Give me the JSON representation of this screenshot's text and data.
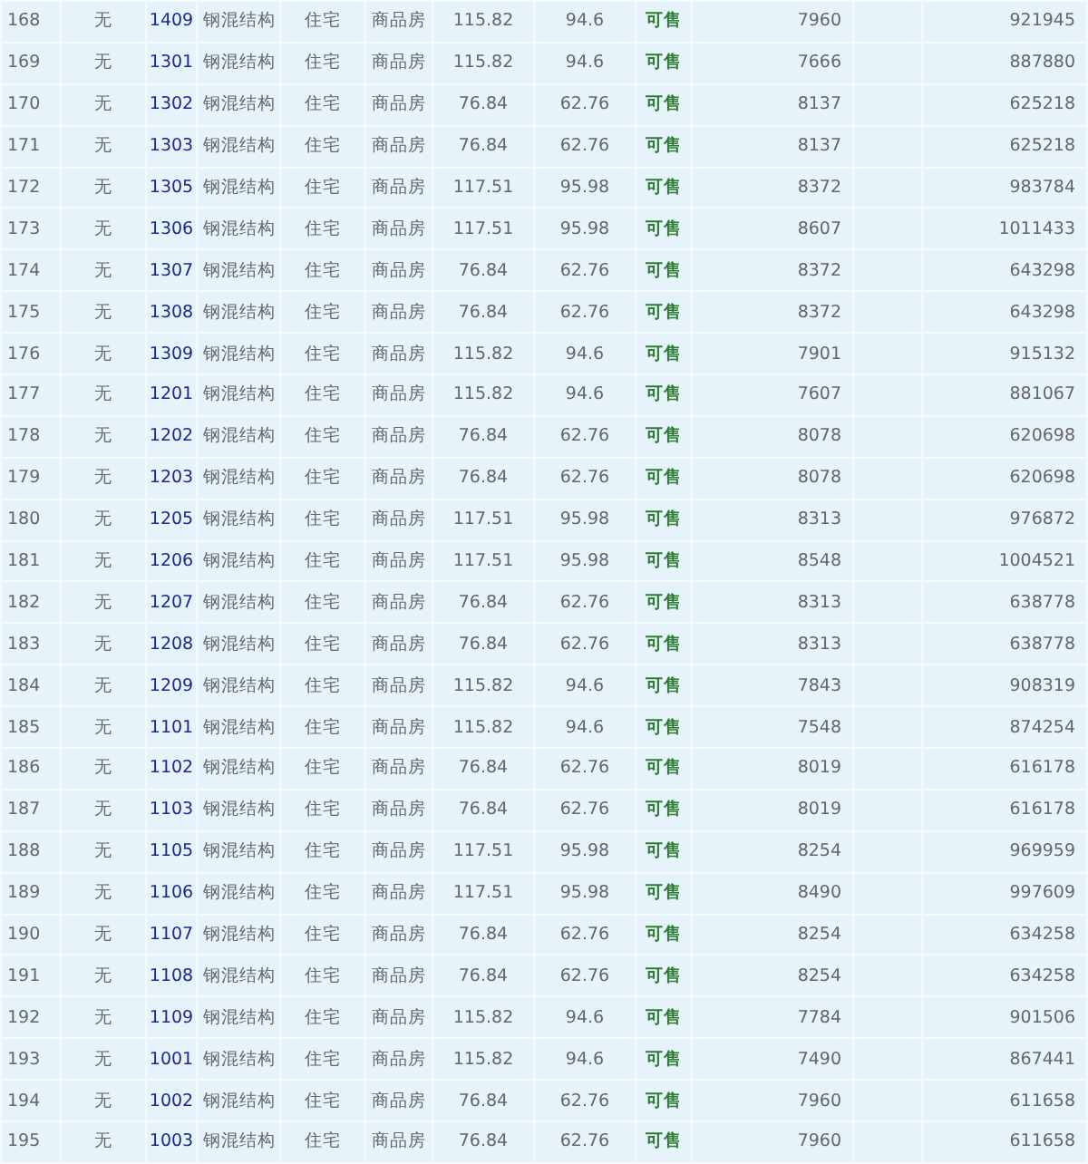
{
  "table": {
    "rows": [
      [
        "168",
        "无",
        "1409",
        "钢混结构",
        "住宅",
        "商品房",
        "115.82",
        "94.6",
        "可售",
        "7960",
        "921945"
      ],
      [
        "169",
        "无",
        "1301",
        "钢混结构",
        "住宅",
        "商品房",
        "115.82",
        "94.6",
        "可售",
        "7666",
        "887880"
      ],
      [
        "170",
        "无",
        "1302",
        "钢混结构",
        "住宅",
        "商品房",
        "76.84",
        "62.76",
        "可售",
        "8137",
        "625218"
      ],
      [
        "171",
        "无",
        "1303",
        "钢混结构",
        "住宅",
        "商品房",
        "76.84",
        "62.76",
        "可售",
        "8137",
        "625218"
      ],
      [
        "172",
        "无",
        "1305",
        "钢混结构",
        "住宅",
        "商品房",
        "117.51",
        "95.98",
        "可售",
        "8372",
        "983784"
      ],
      [
        "173",
        "无",
        "1306",
        "钢混结构",
        "住宅",
        "商品房",
        "117.51",
        "95.98",
        "可售",
        "8607",
        "1011433"
      ],
      [
        "174",
        "无",
        "1307",
        "钢混结构",
        "住宅",
        "商品房",
        "76.84",
        "62.76",
        "可售",
        "8372",
        "643298"
      ],
      [
        "175",
        "无",
        "1308",
        "钢混结构",
        "住宅",
        "商品房",
        "76.84",
        "62.76",
        "可售",
        "8372",
        "643298"
      ],
      [
        "176",
        "无",
        "1309",
        "钢混结构",
        "住宅",
        "商品房",
        "115.82",
        "94.6",
        "可售",
        "7901",
        "915132"
      ],
      [
        "177",
        "无",
        "1201",
        "钢混结构",
        "住宅",
        "商品房",
        "115.82",
        "94.6",
        "可售",
        "7607",
        "881067"
      ],
      [
        "178",
        "无",
        "1202",
        "钢混结构",
        "住宅",
        "商品房",
        "76.84",
        "62.76",
        "可售",
        "8078",
        "620698"
      ],
      [
        "179",
        "无",
        "1203",
        "钢混结构",
        "住宅",
        "商品房",
        "76.84",
        "62.76",
        "可售",
        "8078",
        "620698"
      ],
      [
        "180",
        "无",
        "1205",
        "钢混结构",
        "住宅",
        "商品房",
        "117.51",
        "95.98",
        "可售",
        "8313",
        "976872"
      ],
      [
        "181",
        "无",
        "1206",
        "钢混结构",
        "住宅",
        "商品房",
        "117.51",
        "95.98",
        "可售",
        "8548",
        "1004521"
      ],
      [
        "182",
        "无",
        "1207",
        "钢混结构",
        "住宅",
        "商品房",
        "76.84",
        "62.76",
        "可售",
        "8313",
        "638778"
      ],
      [
        "183",
        "无",
        "1208",
        "钢混结构",
        "住宅",
        "商品房",
        "76.84",
        "62.76",
        "可售",
        "8313",
        "638778"
      ],
      [
        "184",
        "无",
        "1209",
        "钢混结构",
        "住宅",
        "商品房",
        "115.82",
        "94.6",
        "可售",
        "7843",
        "908319"
      ],
      [
        "185",
        "无",
        "1101",
        "钢混结构",
        "住宅",
        "商品房",
        "115.82",
        "94.6",
        "可售",
        "7548",
        "874254"
      ],
      [
        "186",
        "无",
        "1102",
        "钢混结构",
        "住宅",
        "商品房",
        "76.84",
        "62.76",
        "可售",
        "8019",
        "616178"
      ],
      [
        "187",
        "无",
        "1103",
        "钢混结构",
        "住宅",
        "商品房",
        "76.84",
        "62.76",
        "可售",
        "8019",
        "616178"
      ],
      [
        "188",
        "无",
        "1105",
        "钢混结构",
        "住宅",
        "商品房",
        "117.51",
        "95.98",
        "可售",
        "8254",
        "969959"
      ],
      [
        "189",
        "无",
        "1106",
        "钢混结构",
        "住宅",
        "商品房",
        "117.51",
        "95.98",
        "可售",
        "8490",
        "997609"
      ],
      [
        "190",
        "无",
        "1107",
        "钢混结构",
        "住宅",
        "商品房",
        "76.84",
        "62.76",
        "可售",
        "8254",
        "634258"
      ],
      [
        "191",
        "无",
        "1108",
        "钢混结构",
        "住宅",
        "商品房",
        "76.84",
        "62.76",
        "可售",
        "8254",
        "634258"
      ],
      [
        "192",
        "无",
        "1109",
        "钢混结构",
        "住宅",
        "商品房",
        "115.82",
        "94.6",
        "可售",
        "7784",
        "901506"
      ],
      [
        "193",
        "无",
        "1001",
        "钢混结构",
        "住宅",
        "商品房",
        "115.82",
        "94.6",
        "可售",
        "7490",
        "867441"
      ],
      [
        "194",
        "无",
        "1002",
        "钢混结构",
        "住宅",
        "商品房",
        "76.84",
        "62.76",
        "可售",
        "7960",
        "611658"
      ],
      [
        "195",
        "无",
        "1003",
        "钢混结构",
        "住宅",
        "商品房",
        "76.84",
        "62.76",
        "可售",
        "7960",
        "611658"
      ]
    ]
  }
}
